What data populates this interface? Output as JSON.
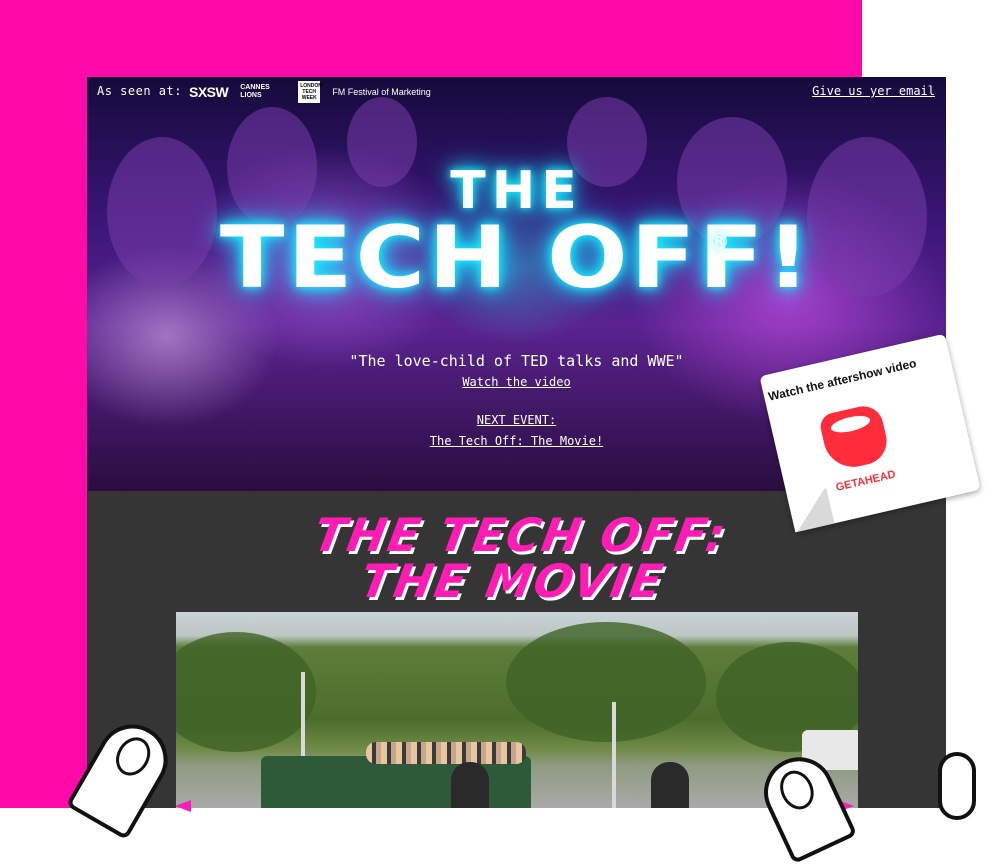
{
  "header": {
    "as_seen_at": "As seen at:",
    "logos": [
      "SXSW",
      "CANNES LIONS",
      "LONDON TECH WEEK",
      "FM Festival of Marketing"
    ],
    "email_link": "Give us yer email"
  },
  "hero": {
    "title_line1": "THE",
    "title_line2": "TECH OFF!",
    "registered": "®",
    "quote": "\"The love-child of TED talks and WWE\"",
    "watch_video": "Watch the video",
    "next_event_label": "NEXT EVENT:",
    "next_event_link": "The Tech Off: The Movie!"
  },
  "sticker": {
    "text": "Watch the aftershow video",
    "brand": "GETAHEAD"
  },
  "movie": {
    "title_line1": "THE TECH OFF:",
    "title_line2": "THE MOVIE"
  },
  "colors": {
    "accent_pink": "#ff0aa8",
    "neon_cyan": "#19f0ff",
    "section_bg": "#353535",
    "getahead_red": "#ff2d3c"
  },
  "icons": [
    "sxsw-logo",
    "cannes-lions-logo",
    "london-tech-week-logo",
    "festival-of-marketing-logo",
    "getahead-head-icon",
    "pointing-hand-icon",
    "arrow-left-icon",
    "arrow-right-icon"
  ]
}
